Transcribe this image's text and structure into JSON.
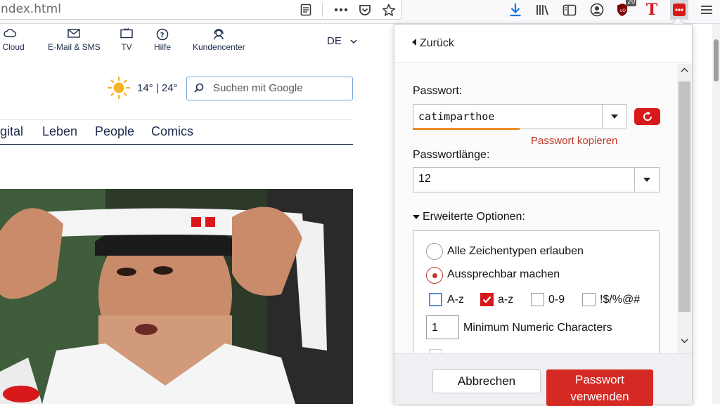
{
  "browser": {
    "url": "ndex.html",
    "toolbar_icons": [
      "reader-view-icon",
      "more-icon",
      "pocket-icon",
      "bookmark-star-icon",
      "download-icon",
      "library-icon",
      "sidebar-icon",
      "account-icon",
      "ublock-icon",
      "tab-extension-icon",
      "password-extension-icon",
      "menu-icon"
    ],
    "ublock_badge": "20",
    "t_glyph": "T",
    "accent_download": "#1a73e8",
    "accent_extension": "#d7191c"
  },
  "site": {
    "nav": [
      {
        "label": "y Cloud",
        "icon": "cloud-icon"
      },
      {
        "label": "E-Mail & SMS",
        "icon": "mail-icon"
      },
      {
        "label": "TV",
        "icon": "tv-icon"
      },
      {
        "label": "Hilfe",
        "icon": "help-icon"
      },
      {
        "label": "Kundencenter",
        "icon": "support-icon"
      }
    ],
    "language": "DE",
    "weather": "14° | 24°",
    "search_placeholder": "Suchen mit Google",
    "categories": [
      "igital",
      "Leben",
      "People",
      "Comics"
    ]
  },
  "panel": {
    "back_label": "Zurück",
    "password_label": "Passwort:",
    "password_value": "catimparthoe",
    "copy_link": "Passwort kopieren",
    "length_label": "Passwortlänge:",
    "length_value": "12",
    "advanced_title": "Erweiterte Optionen:",
    "radio_options": [
      {
        "label": "Alle Zeichentypen erlauben",
        "selected": false
      },
      {
        "label": "Aussprechbar machen",
        "selected": true
      }
    ],
    "charsets": [
      {
        "label": "A-z",
        "checked": false
      },
      {
        "label": "a-z",
        "checked": true
      },
      {
        "label": "0-9",
        "checked": false
      },
      {
        "label": "!$/%@#",
        "checked": false
      }
    ],
    "min_numeric_value": "1",
    "min_numeric_label": "Minimum Numeric Characters",
    "cancel_label": "Abbrechen",
    "use_label_line1": "Passwort",
    "use_label_line2": "verwenden",
    "accent": "#d52a24"
  }
}
